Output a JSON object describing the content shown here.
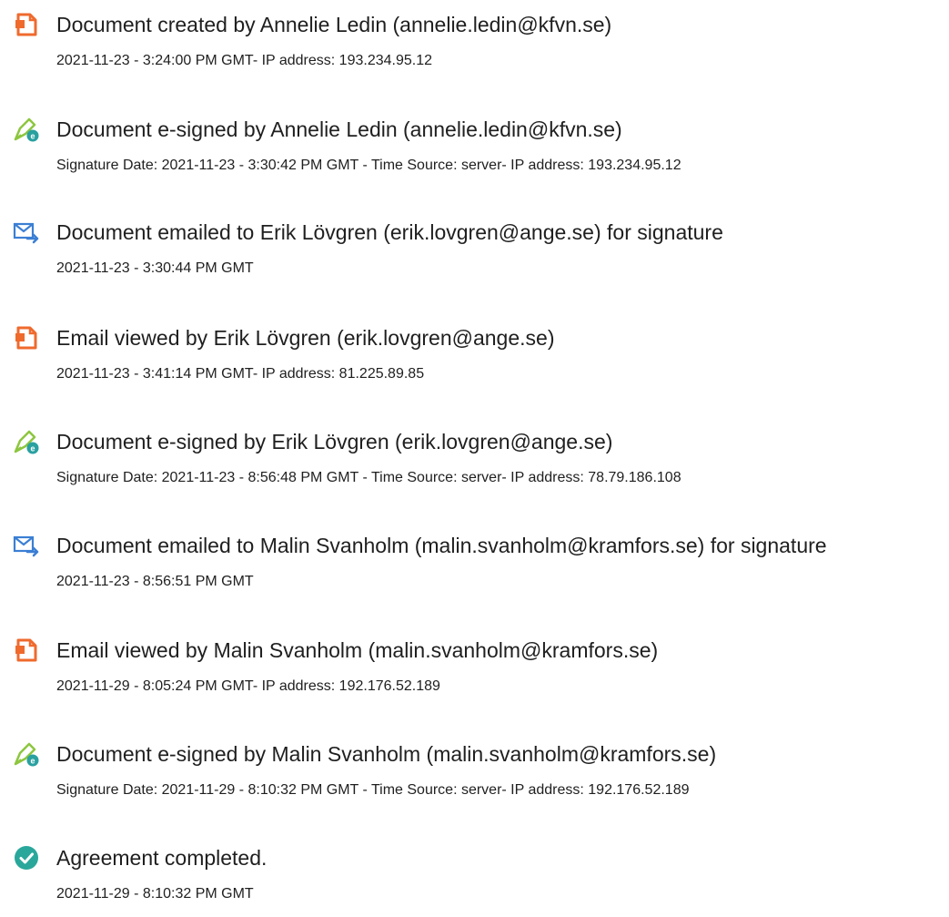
{
  "colors": {
    "pdf_icon": "#ef6a2d",
    "sign_pen": "#8dc63f",
    "sign_badge": "#2aa0a0",
    "email_icon": "#3b7fd4",
    "complete_icon": "#2aa79b"
  },
  "entries": [
    {
      "icon": "document-created-icon",
      "title": "Document created by Annelie Ledin (annelie.ledin@kfvn.se)",
      "detail": "2021-11-23 - 3:24:00 PM GMT- IP address: 193.234.95.12"
    },
    {
      "icon": "e-sign-icon",
      "title": "Document e-signed by Annelie Ledin (annelie.ledin@kfvn.se)",
      "detail": "Signature Date: 2021-11-23 - 3:30:42 PM GMT - Time Source: server- IP address: 193.234.95.12"
    },
    {
      "icon": "email-sent-icon",
      "title": "Document emailed to Erik Lövgren (erik.lovgren@ange.se) for signature",
      "detail": "2021-11-23 - 3:30:44 PM GMT"
    },
    {
      "icon": "document-viewed-icon",
      "title": "Email viewed by Erik Lövgren (erik.lovgren@ange.se)",
      "detail": "2021-11-23 - 3:41:14 PM GMT- IP address: 81.225.89.85"
    },
    {
      "icon": "e-sign-icon",
      "title": "Document e-signed by Erik Lövgren (erik.lovgren@ange.se)",
      "detail": "Signature Date: 2021-11-23 - 8:56:48 PM GMT - Time Source: server- IP address: 78.79.186.108"
    },
    {
      "icon": "email-sent-icon",
      "title": "Document emailed to Malin Svanholm (malin.svanholm@kramfors.se) for signature",
      "detail": "2021-11-23 - 8:56:51 PM GMT"
    },
    {
      "icon": "document-viewed-icon",
      "title": "Email viewed by Malin Svanholm (malin.svanholm@kramfors.se)",
      "detail": "2021-11-29 - 8:05:24 PM GMT- IP address: 192.176.52.189"
    },
    {
      "icon": "e-sign-icon",
      "title": "Document e-signed by Malin Svanholm (malin.svanholm@kramfors.se)",
      "detail": "Signature Date: 2021-11-29 - 8:10:32 PM GMT - Time Source: server- IP address: 192.176.52.189"
    },
    {
      "icon": "agreement-completed-icon",
      "title": "Agreement completed.",
      "detail": "2021-11-29 - 8:10:32 PM GMT"
    }
  ]
}
